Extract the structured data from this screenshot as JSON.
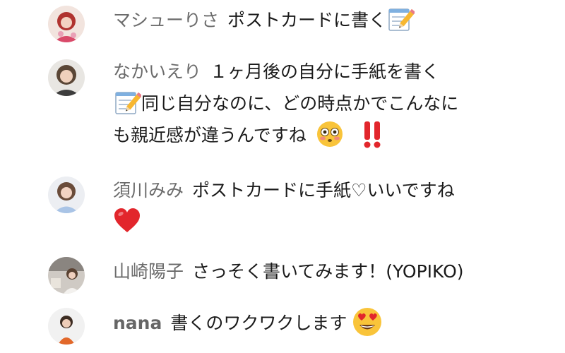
{
  "comments": [
    {
      "author": "マシューりさ",
      "text": "ポストカードに書く",
      "emoji": "memo-icon"
    },
    {
      "author": "なかいえり",
      "line1": "１ヶ月後の自分に手紙を書く",
      "line2": "同じ自分なのに、どの時点かでこんなに",
      "line3": "も親近感が違うんですね",
      "emojis": [
        "memo-icon",
        "flushed-face-icon",
        "double-exclamation-icon"
      ]
    },
    {
      "author": "須川みみ",
      "text": "ポストカードに手紙♡いいですね",
      "emoji": "red-heart-icon"
    },
    {
      "author": "山崎陽子",
      "text": "さっそく書いてみます！(YOPIKO)"
    },
    {
      "author": "nana",
      "text": "書くのワクワクします",
      "emoji": "heart-eyes-face-icon"
    }
  ],
  "colors": {
    "author_text": "#6b6b6b",
    "body_text": "#1a1a1a",
    "accent_red": "#e2262c",
    "emoji_yellow": "#f9c43a"
  }
}
